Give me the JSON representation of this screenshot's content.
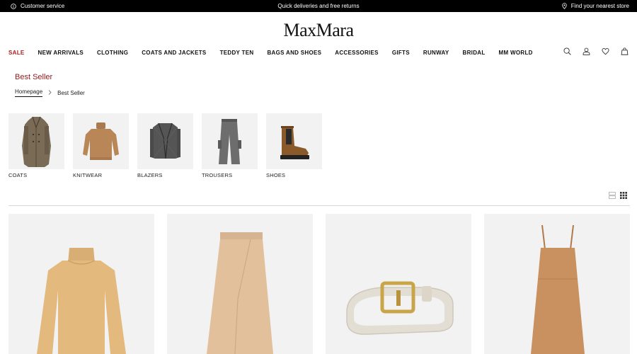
{
  "topbar": {
    "customer_service": "Customer service",
    "promo": "Quick deliveries and free returns",
    "store_finder": "Find your nearest store"
  },
  "brand": {
    "logo": "MaxMara"
  },
  "nav": {
    "items": [
      {
        "label": "SALE"
      },
      {
        "label": "NEW ARRIVALS"
      },
      {
        "label": "CLOTHING"
      },
      {
        "label": "COATS AND JACKETS"
      },
      {
        "label": "TEDDY TEN"
      },
      {
        "label": "BAGS AND SHOES"
      },
      {
        "label": "ACCESSORIES"
      },
      {
        "label": "GIFTS"
      },
      {
        "label": "RUNWAY"
      },
      {
        "label": "BRIDAL"
      },
      {
        "label": "MM WORLD"
      }
    ],
    "icons": [
      "search-icon",
      "user-icon",
      "heart-icon",
      "bag-icon"
    ]
  },
  "page": {
    "title": "Best Seller",
    "breadcrumb": {
      "home": "Homepage",
      "current": "Best Seller"
    }
  },
  "categories": [
    {
      "label": "COATS"
    },
    {
      "label": "KNITWEAR"
    },
    {
      "label": "BLAZERS"
    },
    {
      "label": "TROUSERS"
    },
    {
      "label": "SHOES"
    }
  ],
  "view_toggle": [
    "list-view-icon",
    "grid-view-icon"
  ],
  "products": [
    {
      "name": "turtleneck-sweater",
      "icon": "sweater-image"
    },
    {
      "name": "maxi-skirt",
      "icon": "skirt-image"
    },
    {
      "name": "leather-belt",
      "icon": "belt-image"
    },
    {
      "name": "camel-dress",
      "icon": "dress-image"
    }
  ],
  "colors": {
    "sale_red": "#b31b1b",
    "title_red": "#8e1b1b",
    "topbar_bg": "#000000",
    "tile_bg": "#f2f2f2"
  }
}
